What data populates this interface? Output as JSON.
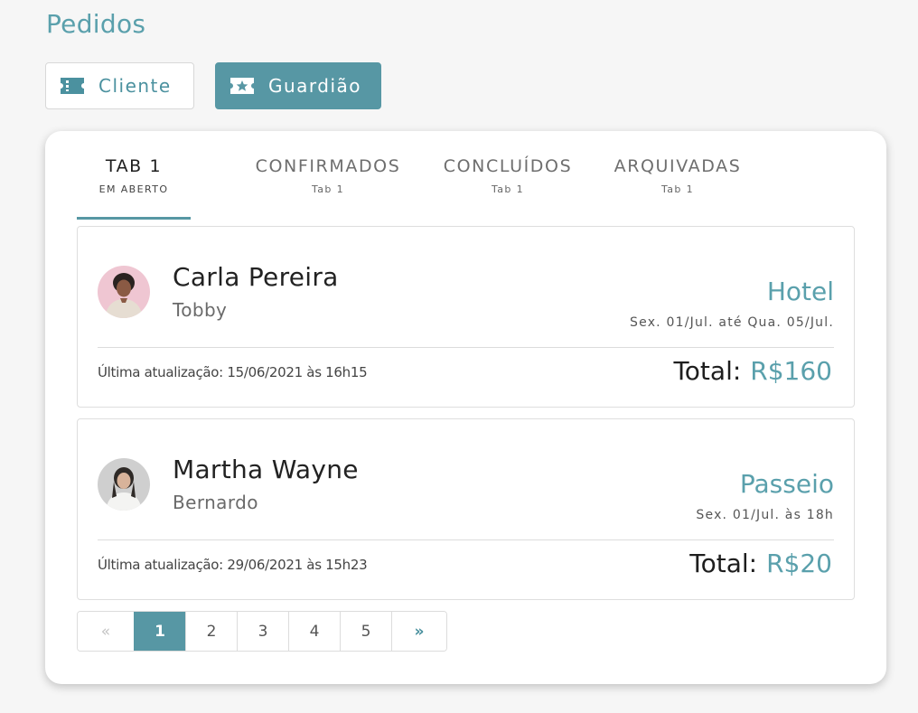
{
  "page": {
    "title": "Pedidos"
  },
  "roles": {
    "client_label": "Cliente",
    "guardian_label": "Guardião",
    "active": "guardian"
  },
  "tabs": [
    {
      "title": "TAB 1",
      "subtitle": "EM ABERTO",
      "active": true
    },
    {
      "title": "CONFIRMADOS",
      "subtitle": "Tab 1",
      "active": false
    },
    {
      "title": "CONCLUÍDOS",
      "subtitle": "Tab 1",
      "active": false
    },
    {
      "title": "ARQUIVADAS",
      "subtitle": "Tab 1",
      "active": false
    }
  ],
  "orders": [
    {
      "customer": "Carla Pereira",
      "pet": "Tobby",
      "service": "Hotel",
      "date": "Sex. 01/Jul. até Qua. 05/Jul.",
      "updated": "Última atualização: 15/06/2021 às 16h15",
      "total_label": "Total:",
      "total_value": "R$160"
    },
    {
      "customer": "Martha Wayne",
      "pet": "Bernardo",
      "service": "Passeio",
      "date": "Sex. 01/Jul. às 18h",
      "updated": "Última atualização: 29/06/2021 às 15h23",
      "total_label": "Total:",
      "total_value": "R$20"
    }
  ],
  "pagination": {
    "prev": "«",
    "pages": [
      "1",
      "2",
      "3",
      "4",
      "5"
    ],
    "next": "»",
    "current": "1"
  },
  "colors": {
    "accent": "#5797a4",
    "accent_text": "#5aa0ac"
  },
  "icons": {
    "client": "ticket-icon",
    "guardian": "star-ticket-icon",
    "avatar": "user-avatar"
  }
}
